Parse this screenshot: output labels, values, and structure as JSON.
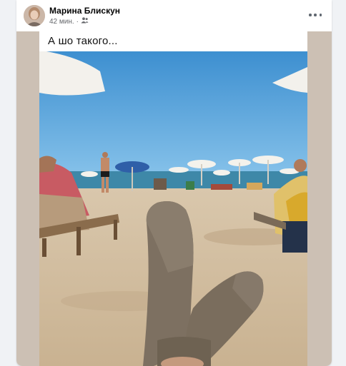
{
  "post": {
    "author_name": "Марина Блискун",
    "timestamp": "42 мин.",
    "separator": "·",
    "audience_icon": "friends-icon",
    "more_icon": "more-options-icon"
  },
  "image": {
    "caption": "А шо такого...",
    "scene": "beach-photo-woolen-socks"
  },
  "colors": {
    "background": "#f0f2f5",
    "card": "#ffffff",
    "media_frame": "#ccc0b4",
    "name_text": "#050505",
    "meta_text": "#65676b"
  }
}
